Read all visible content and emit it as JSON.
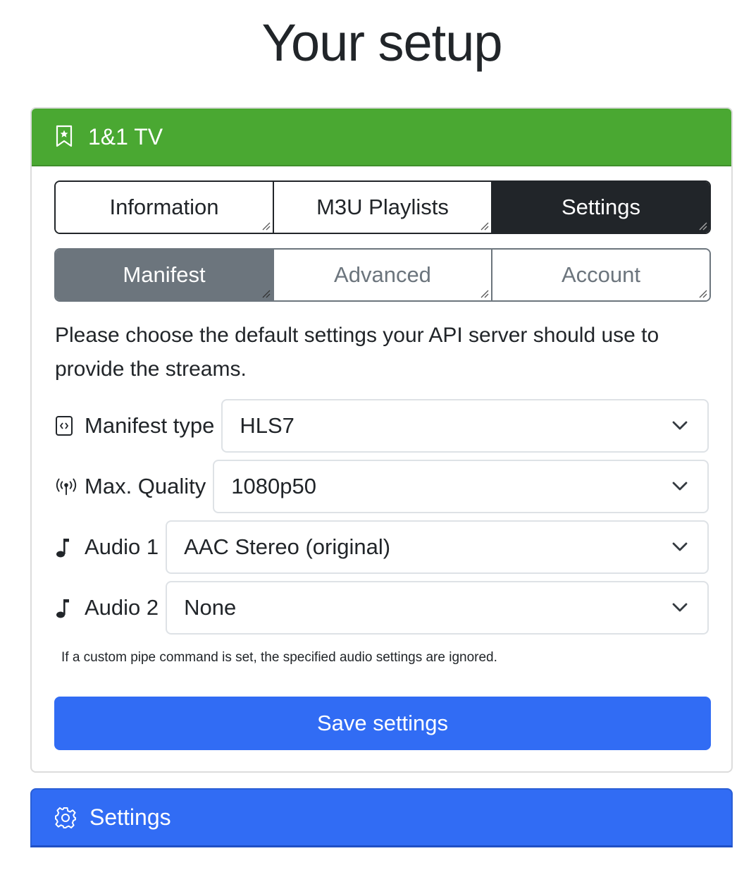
{
  "page": {
    "title": "Your setup"
  },
  "provider_card": {
    "title": "1&1 TV",
    "header_color": "#4aa832",
    "icon": "bookmark-star-icon",
    "main_tabs": [
      {
        "label": "Information",
        "active": false
      },
      {
        "label": "M3U Playlists",
        "active": false
      },
      {
        "label": "Settings",
        "active": true
      }
    ],
    "sub_tabs": [
      {
        "label": "Manifest",
        "active": true
      },
      {
        "label": "Advanced",
        "active": false
      },
      {
        "label": "Account",
        "active": false
      }
    ],
    "description": "Please choose the default settings your API server should use to provide the streams.",
    "fields": [
      {
        "label": "Manifest type",
        "icon": "file-code-icon",
        "value": "HLS7"
      },
      {
        "label": "Max. Quality",
        "icon": "broadcast-icon",
        "value": "1080p50"
      },
      {
        "label": "Audio 1",
        "icon": "music-note-icon",
        "value": "AAC Stereo (original)"
      },
      {
        "label": "Audio 2",
        "icon": "music-note-icon",
        "value": "None"
      }
    ],
    "note": "If a custom pipe command is set, the specified audio settings are ignored.",
    "save_label": "Save settings",
    "save_color": "#316cf4"
  },
  "settings_card": {
    "title": "Settings",
    "icon": "gear-icon",
    "header_color": "#316cf4"
  }
}
